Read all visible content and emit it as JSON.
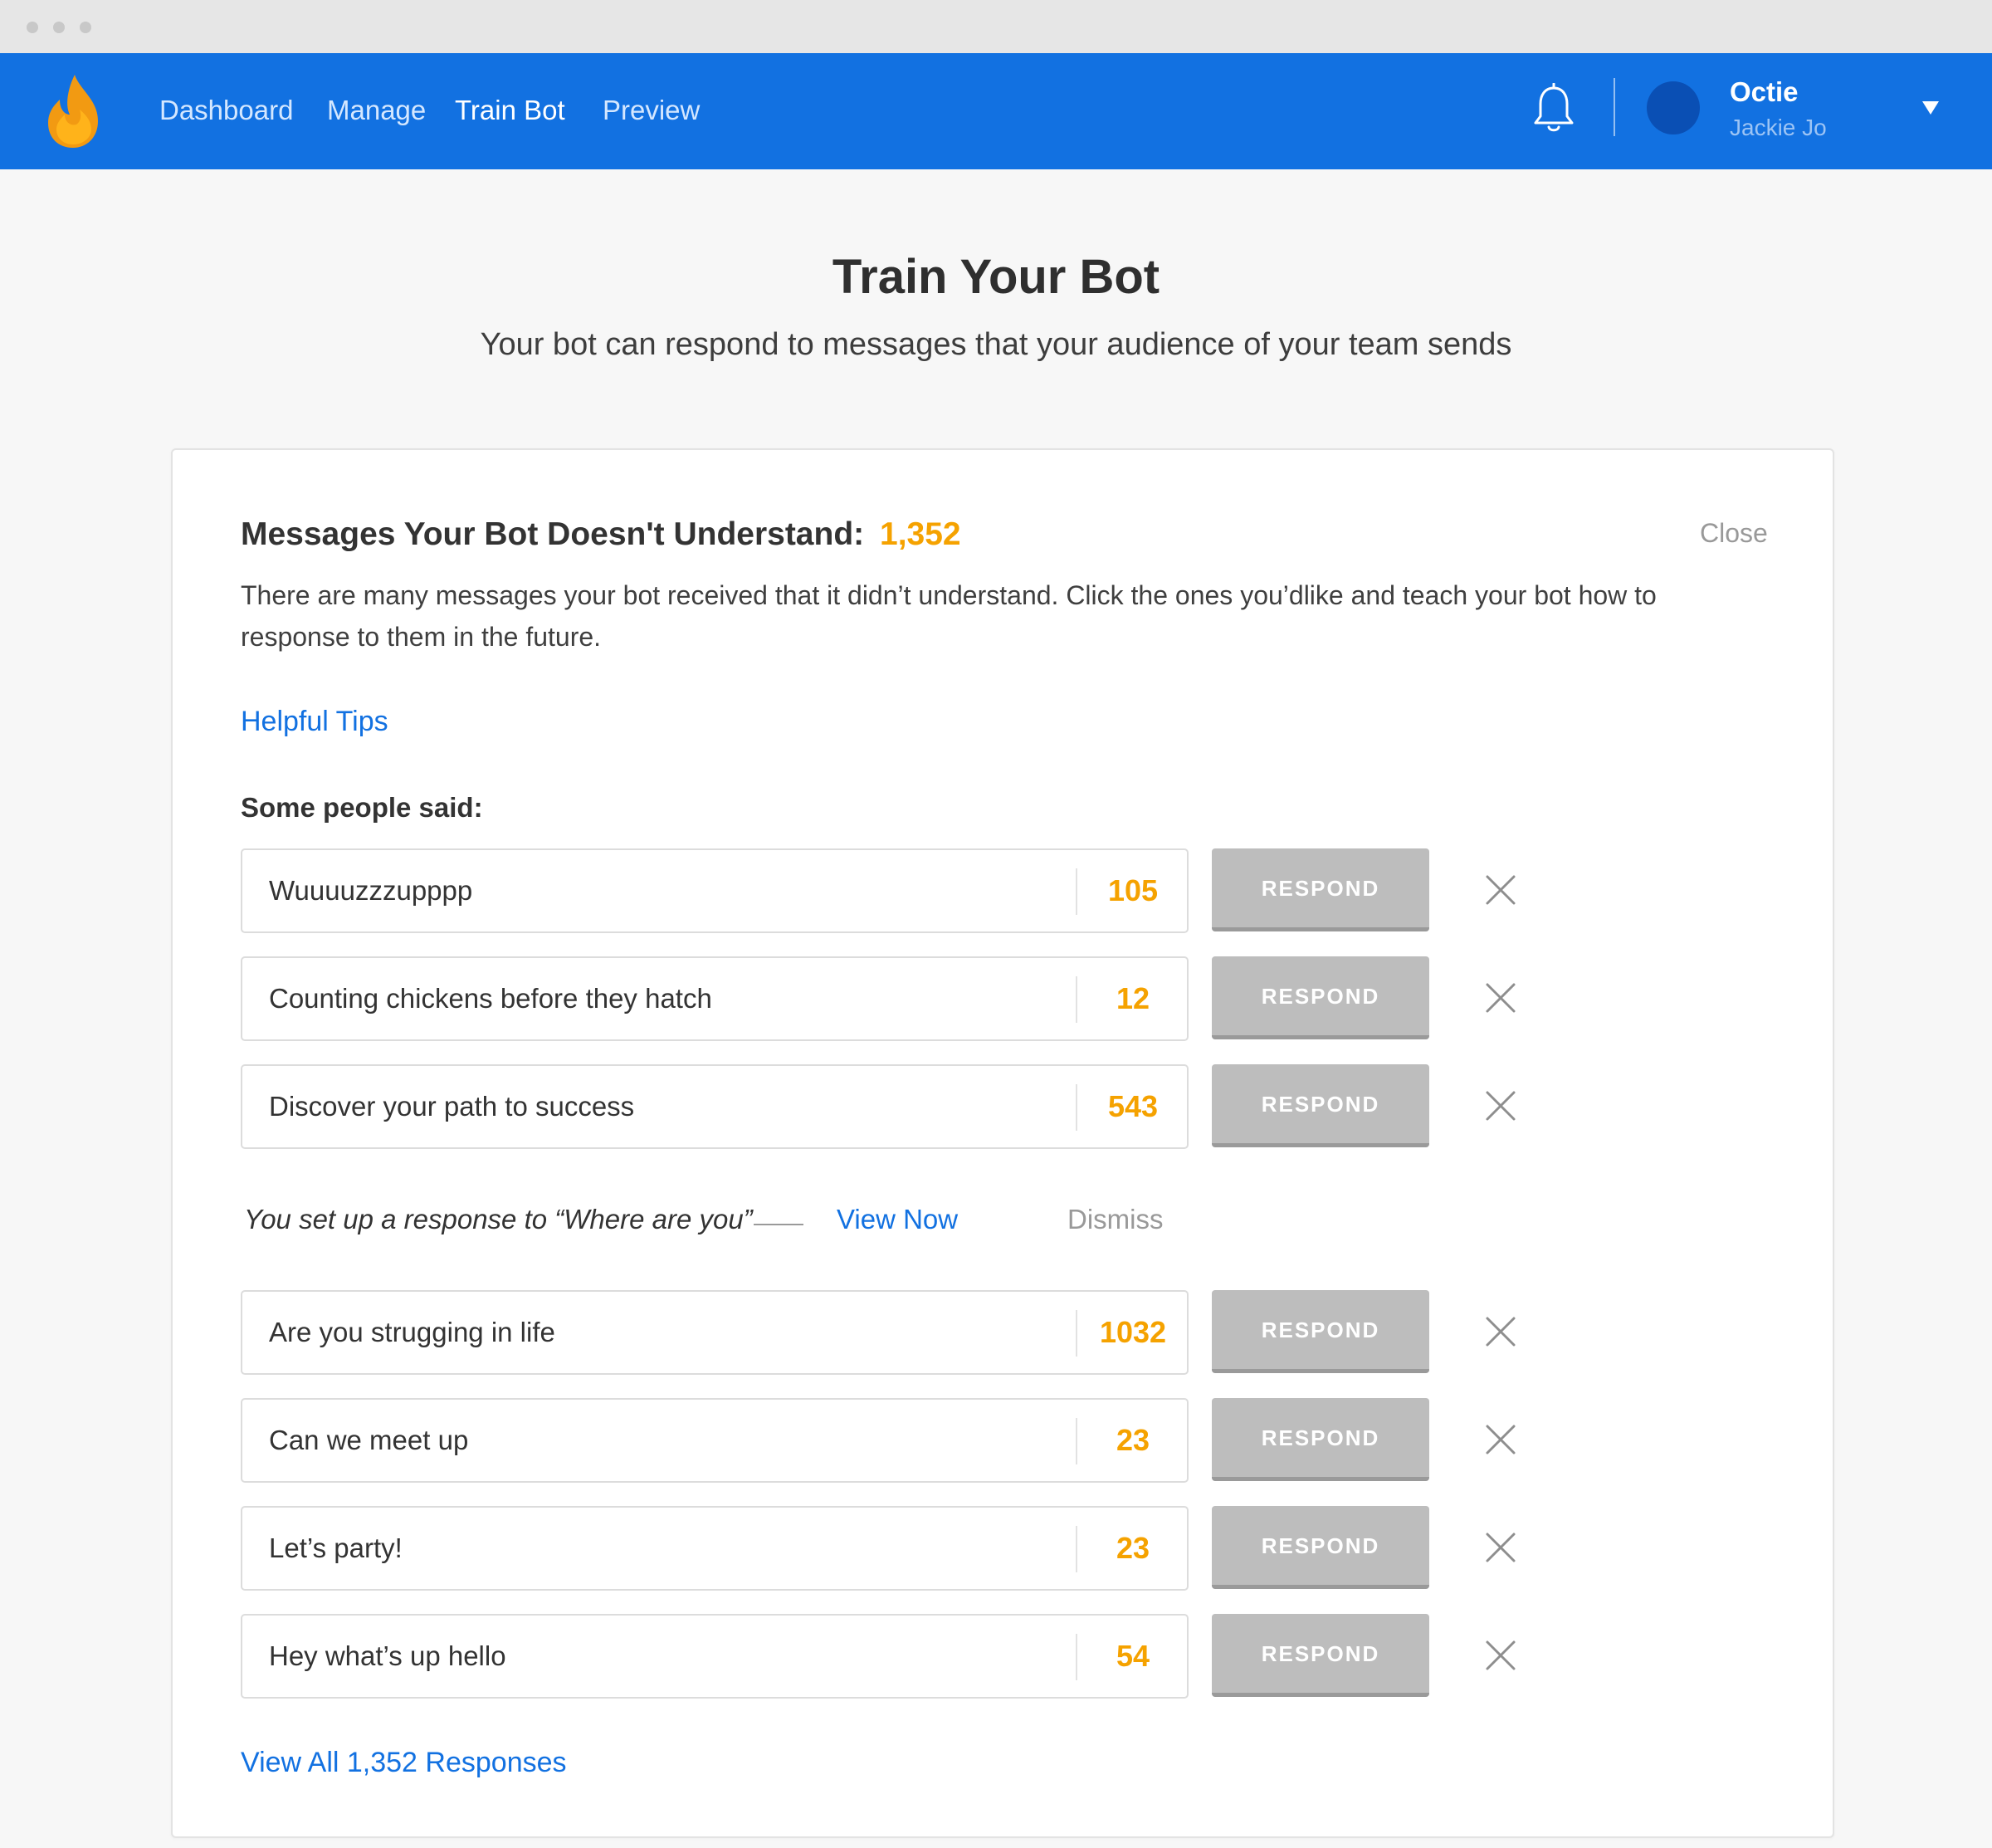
{
  "nav": {
    "links": [
      "Dashboard",
      "Manage",
      "Train Bot",
      "Preview"
    ],
    "active": "Train Bot",
    "user": {
      "name": "Octie",
      "sub": "Jackie Jo"
    },
    "icons": {
      "logo": "flame-logo",
      "notifications": "bell-icon",
      "menu": "caret-down-icon"
    }
  },
  "page": {
    "title": "Train Your Bot",
    "subtitle": "Your bot can respond to messages that your audience of your team sends"
  },
  "card": {
    "title": "Messages Your Bot Doesn't Understand:",
    "count": "1,352",
    "close": "Close",
    "description": "There are many messages your bot received that it didn’t understand. Click the ones you’dlike and teach your bot how to response to them in the future.",
    "tips": "Helpful Tips",
    "section_label": "Some people said:",
    "respond_label": "RESPOND",
    "messages_top": [
      {
        "text": "Wuuuuzzzupppp",
        "count": "105"
      },
      {
        "text": "Counting chickens before they hatch",
        "count": "12"
      },
      {
        "text": "Discover your path to success",
        "count": "543"
      }
    ],
    "notice": {
      "text": "You set up a response to “Where are you”",
      "view_now": "View Now",
      "dismiss": "Dismiss"
    },
    "messages_bottom": [
      {
        "text": "Are you strugging in life",
        "count": "1032"
      },
      {
        "text": "Can we meet up",
        "count": "23"
      },
      {
        "text": "Let’s party!",
        "count": "23"
      },
      {
        "text": "Hey what’s up hello",
        "count": "54"
      }
    ],
    "view_all": "View All 1,352 Responses"
  },
  "colors": {
    "nav": "#1271e1",
    "accent": "#f5a200",
    "link": "#1271e1",
    "button": "#bdbdbd"
  }
}
